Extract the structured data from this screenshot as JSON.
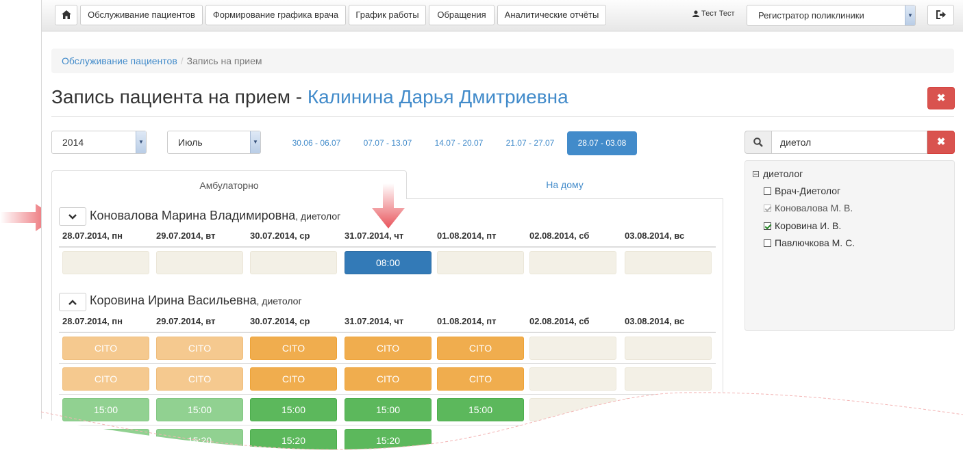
{
  "nav": {
    "home_icon": "home-icon",
    "items": [
      "Обслуживание пациентов",
      "Формирование графика врача",
      "График работы",
      "Обращения",
      "Аналитические отчёты"
    ],
    "user": "Тест Тест",
    "role": "Регистратор поликлиники",
    "logout_icon": "logout-icon"
  },
  "breadcrumb": {
    "parent": "Обслуживание пациентов",
    "current": "Запись на прием"
  },
  "title": {
    "prefix": "Запись пациента на прием - ",
    "patient": "Калинина Дарья Дмитриевна"
  },
  "close_label": "✖",
  "filters": {
    "year": "2014",
    "month": "Июль",
    "weeks": [
      "30.06 - 06.07",
      "07.07 - 13.07",
      "14.07 - 20.07",
      "21.07 - 27.07",
      "28.07 - 03.08"
    ],
    "active_week": "28.07 - 03.08"
  },
  "tabs": {
    "active": "Амбулаторно",
    "other": "На дому"
  },
  "days": [
    "28.07.2014, пн",
    "29.07.2014, вт",
    "30.07.2014, ср",
    "31.07.2014, чт",
    "01.08.2014, пт",
    "02.08.2014, сб",
    "03.08.2014, вс"
  ],
  "doctors": [
    {
      "name": "Коновалова Марина Владимировна",
      "specialty": ", диетолог",
      "toggle_icon": "chevron-down-icon",
      "slots": [
        "",
        "",
        "",
        "08:00",
        "",
        "",
        ""
      ]
    },
    {
      "name": "Коровина Ирина Васильевна",
      "specialty": ", диетолог",
      "toggle_icon": "chevron-up-icon",
      "rows": [
        [
          "CITO",
          "CITO",
          "CITO",
          "CITO",
          "CITO",
          "",
          ""
        ],
        [
          "CITO",
          "CITO",
          "CITO",
          "CITO",
          "CITO",
          "",
          ""
        ],
        [
          "15:00",
          "15:00",
          "15:00",
          "15:00",
          "15:00",
          "",
          ""
        ],
        [
          "15:20",
          "15:20",
          "15:20",
          "15:20",
          "",
          "",
          ""
        ]
      ]
    }
  ],
  "search": {
    "value": "диетол",
    "icon": "search-icon",
    "clear_label": "✖"
  },
  "tree": {
    "group": "диетолог",
    "items": [
      {
        "label": "Врач-Диетолог",
        "checked": false
      },
      {
        "label": "Коновалова М. В.",
        "checked": true
      },
      {
        "label": "Коровина И. В.",
        "checked": true
      },
      {
        "label": "Павлючкова М. С.",
        "checked": false
      }
    ]
  },
  "colors": {
    "accent": "#428bca",
    "danger": "#d9534f",
    "cito": "#f0ad4e",
    "free": "#5cb85c",
    "arrow": "#e8545b"
  }
}
